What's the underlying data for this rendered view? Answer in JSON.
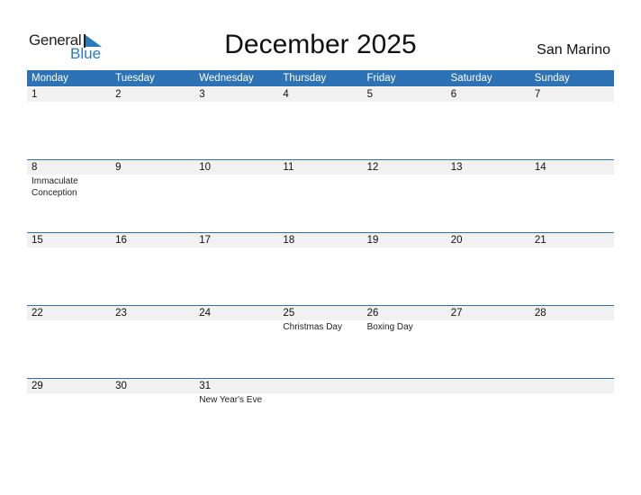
{
  "logo": {
    "line1": "General",
    "line2": "Blue"
  },
  "title": "December 2025",
  "country": "San Marino",
  "colors": {
    "accent": "#2d72b4",
    "band": "#f1f1f1"
  },
  "weekdays": [
    "Monday",
    "Tuesday",
    "Wednesday",
    "Thursday",
    "Friday",
    "Saturday",
    "Sunday"
  ],
  "weeks": [
    [
      {
        "day": "1",
        "event": ""
      },
      {
        "day": "2",
        "event": ""
      },
      {
        "day": "3",
        "event": ""
      },
      {
        "day": "4",
        "event": ""
      },
      {
        "day": "5",
        "event": ""
      },
      {
        "day": "6",
        "event": ""
      },
      {
        "day": "7",
        "event": ""
      }
    ],
    [
      {
        "day": "8",
        "event": "Immaculate Conception"
      },
      {
        "day": "9",
        "event": ""
      },
      {
        "day": "10",
        "event": ""
      },
      {
        "day": "11",
        "event": ""
      },
      {
        "day": "12",
        "event": ""
      },
      {
        "day": "13",
        "event": ""
      },
      {
        "day": "14",
        "event": ""
      }
    ],
    [
      {
        "day": "15",
        "event": ""
      },
      {
        "day": "16",
        "event": ""
      },
      {
        "day": "17",
        "event": ""
      },
      {
        "day": "18",
        "event": ""
      },
      {
        "day": "19",
        "event": ""
      },
      {
        "day": "20",
        "event": ""
      },
      {
        "day": "21",
        "event": ""
      }
    ],
    [
      {
        "day": "22",
        "event": ""
      },
      {
        "day": "23",
        "event": ""
      },
      {
        "day": "24",
        "event": ""
      },
      {
        "day": "25",
        "event": "Christmas Day"
      },
      {
        "day": "26",
        "event": "Boxing Day"
      },
      {
        "day": "27",
        "event": ""
      },
      {
        "day": "28",
        "event": ""
      }
    ],
    [
      {
        "day": "29",
        "event": ""
      },
      {
        "day": "30",
        "event": ""
      },
      {
        "day": "31",
        "event": "New Year's Eve"
      },
      {
        "day": "",
        "event": ""
      },
      {
        "day": "",
        "event": ""
      },
      {
        "day": "",
        "event": ""
      },
      {
        "day": "",
        "event": ""
      }
    ]
  ]
}
